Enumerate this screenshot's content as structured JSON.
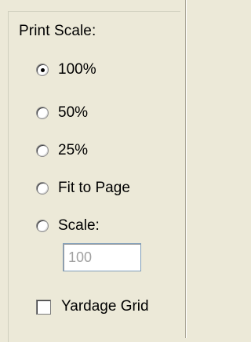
{
  "print_scale": {
    "title": "Print Scale:",
    "options": [
      {
        "label": "100%",
        "checked": true
      },
      {
        "label": "50%",
        "checked": false
      },
      {
        "label": "25%",
        "checked": false
      },
      {
        "label": "Fit to Page",
        "checked": false
      },
      {
        "label": "Scale:",
        "checked": false
      }
    ],
    "scale_value": "100"
  },
  "yardage_grid": {
    "label": "Yardage Grid",
    "checked": false
  }
}
